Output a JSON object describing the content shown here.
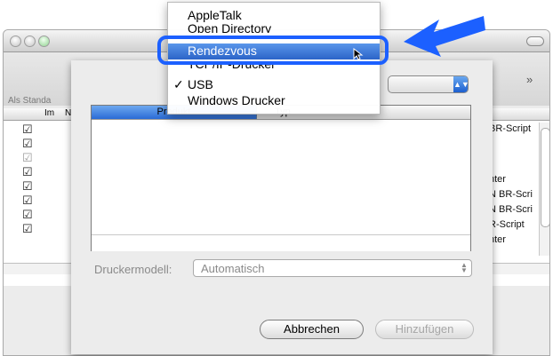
{
  "background_window": {
    "left_label": "Als Standa",
    "headers": [
      "Im",
      "N"
    ],
    "checkbox_count": 7,
    "right_column_texts": [
      "BR-Script",
      "",
      "",
      "nter",
      "N BR-Scri",
      "N BR-Scri",
      "R-Script",
      "nter"
    ]
  },
  "sheet": {
    "list": {
      "col_product": "Produkt",
      "col_type": "Typ"
    },
    "model": {
      "label": "Druckermodell:",
      "value": "Automatisch"
    },
    "buttons": {
      "cancel": "Abbrechen",
      "add": "Hinzufügen"
    }
  },
  "menu": {
    "items": [
      {
        "label": "AppleTalk",
        "checked": false
      },
      {
        "label": "Open Directory",
        "checked": false
      },
      {
        "label": "Rendezvous",
        "checked": false,
        "selected": true
      },
      {
        "label": "TCP/IP-Drucker",
        "checked": false
      },
      {
        "label": "USB",
        "checked": true
      },
      {
        "label": "Windows Drucker",
        "checked": false
      }
    ],
    "checkmark": "✓"
  },
  "colors": {
    "highlight_ring": "#1c60ff",
    "arrow": "#1c60ff",
    "menu_selection": "#2b64c8"
  }
}
